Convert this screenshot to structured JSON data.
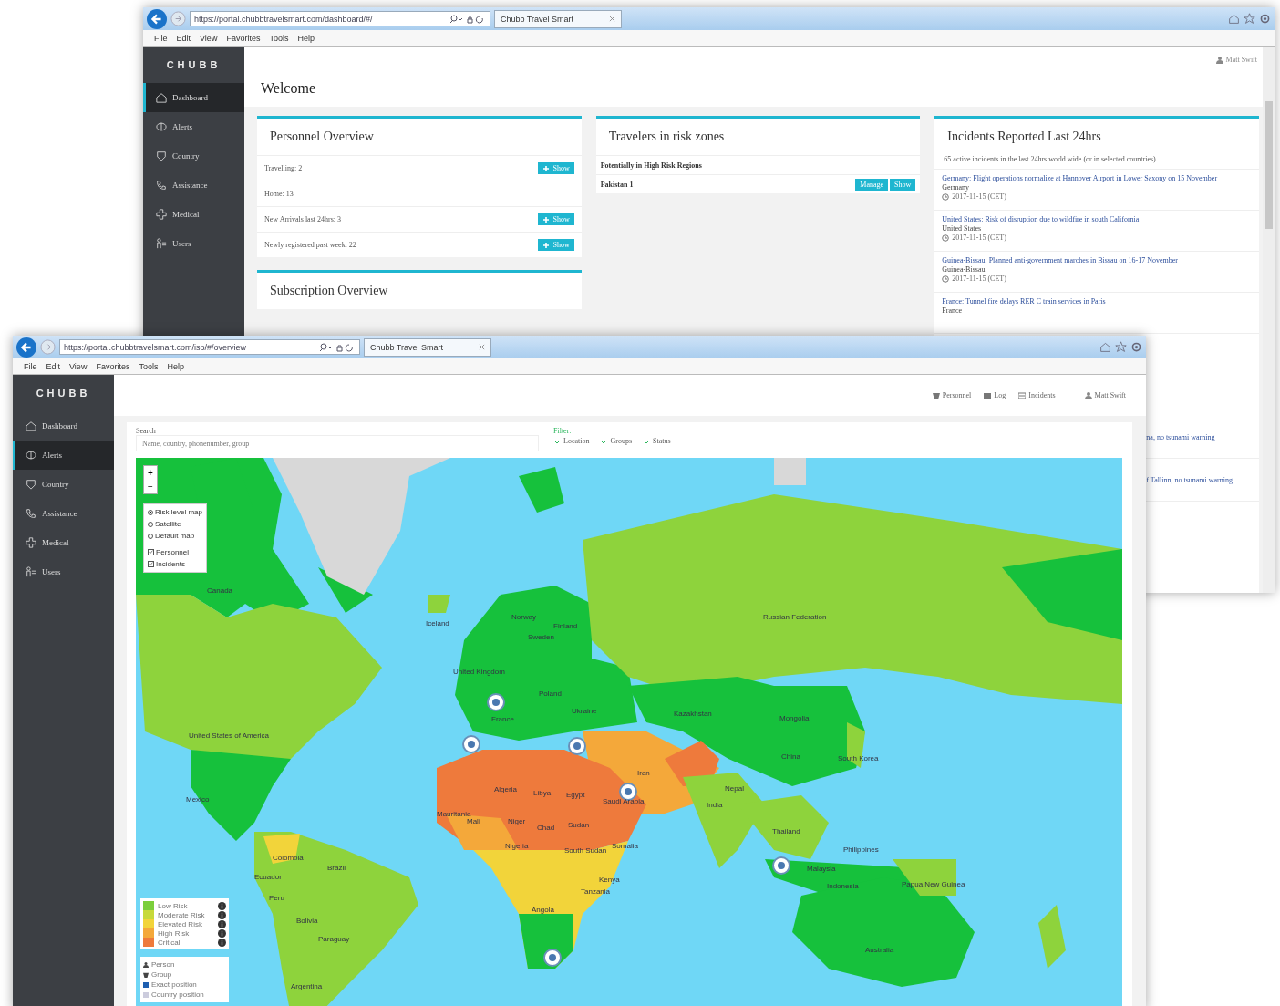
{
  "dashboard_window": {
    "browser": {
      "url": "https://portal.chubbtravelsmart.com/dashboard/#/",
      "tab_title": "Chubb Travel Smart",
      "menu": [
        "File",
        "Edit",
        "View",
        "Favorites",
        "Tools",
        "Help"
      ]
    },
    "logo": "CHUBB",
    "sidebar": [
      {
        "label": "Dashboard",
        "selected": true
      },
      {
        "label": "Alerts",
        "selected": false
      },
      {
        "label": "Country",
        "selected": false
      },
      {
        "label": "Assistance",
        "selected": false
      },
      {
        "label": "Medical",
        "selected": false
      },
      {
        "label": "Users",
        "selected": false
      }
    ],
    "user": "Matt Swift",
    "page_title": "Welcome",
    "personnel": {
      "title": "Personnel Overview",
      "rows": [
        {
          "label": "Travelling: 2",
          "button": "Show"
        },
        {
          "label": "Home: 13"
        },
        {
          "label": "New Arrivals last 24hrs: 3",
          "button": "Show"
        },
        {
          "label": "Newly registered past week: 22",
          "button": "Show"
        }
      ]
    },
    "subscription": {
      "title": "Subscription Overview"
    },
    "travelers": {
      "title": "Travelers in risk zones",
      "subtitle": "Potentially in High Risk Regions",
      "rows": [
        {
          "label": "Pakistan 1",
          "buttons": [
            "Manage",
            "Show"
          ]
        }
      ]
    },
    "incidents": {
      "title": "Incidents Reported Last 24hrs",
      "summary": "65 active incidents in the last 24hrs world wide (or in selected countries).",
      "items": [
        {
          "title": "Germany: Flight operations normalize at Hannover Airport in Lower Saxony on 15 November",
          "location": "Germany",
          "date": "2017-11-15 (CET)"
        },
        {
          "title": "United States: Risk of disruption due to wildfire in south California",
          "location": "United States",
          "date": "2017-11-15 (CET)"
        },
        {
          "title": "Guinea-Bissau: Planned anti-government marches in Bissau on 16-17 November",
          "location": "Guinea-Bissau",
          "date": "2017-11-15 (CET)"
        },
        {
          "title": "France: Tunnel fire delays RER C train services in Paris",
          "location": "France"
        }
      ],
      "fragments": [
        "na, no tsunami warning",
        "f Tallinn, no tsunami warning"
      ]
    }
  },
  "map_window": {
    "browser": {
      "url": "https://portal.chubbtravelsmart.com/iso/#/overview",
      "tab_title": "Chubb Travel Smart",
      "menu": [
        "File",
        "Edit",
        "View",
        "Favorites",
        "Tools",
        "Help"
      ]
    },
    "logo": "CHUBB",
    "sidebar": [
      {
        "label": "Dashboard",
        "selected": false
      },
      {
        "label": "Alerts",
        "selected": true
      },
      {
        "label": "Country",
        "selected": false
      },
      {
        "label": "Assistance",
        "selected": false
      },
      {
        "label": "Medical",
        "selected": false
      },
      {
        "label": "Users",
        "selected": false
      }
    ],
    "nav": [
      "Personnel",
      "Log",
      "Incidents"
    ],
    "user": "Matt Swift",
    "search": {
      "label": "Search",
      "placeholder": "Name, country, phonenumber, group"
    },
    "filter": {
      "label": "Filter:",
      "options": [
        "Location",
        "Groups",
        "Status"
      ]
    },
    "zoom": [
      "+",
      "−"
    ],
    "layers": [
      {
        "label": "Risk level map",
        "kind": "radio",
        "selected": true
      },
      {
        "label": "Satellite",
        "kind": "radio",
        "selected": false
      },
      {
        "label": "Default map",
        "kind": "radio",
        "selected": false
      },
      {
        "label": "Personnel",
        "kind": "checkbox",
        "checked": true
      },
      {
        "label": "Incidents",
        "kind": "checkbox",
        "checked": true
      }
    ],
    "risk_legend": [
      {
        "label": "Low Risk",
        "color": "#7ccf3c"
      },
      {
        "label": "Moderate Risk",
        "color": "#c7d93a"
      },
      {
        "label": "Elevated Risk",
        "color": "#f2d43a"
      },
      {
        "label": "High Risk",
        "color": "#f4a83a"
      },
      {
        "label": "Critical",
        "color": "#ee7a3c"
      }
    ],
    "marker_legend": [
      {
        "label": "Person",
        "kind": "person"
      },
      {
        "label": "Group",
        "kind": "group"
      },
      {
        "label": "Exact position",
        "kind": "exact"
      },
      {
        "label": "Country position",
        "kind": "country"
      }
    ],
    "map_labels": [
      "Canada",
      "United States of America",
      "Mexico",
      "Colombia",
      "Ecuador",
      "Brazil",
      "Peru",
      "Bolivia",
      "Paraguay",
      "Argentina",
      "Iceland",
      "Norway",
      "Sweden",
      "Finland",
      "United Kingdom",
      "France",
      "Poland",
      "Ukraine",
      "Russian Federation",
      "Kazakhstan",
      "Mongolia",
      "China",
      "Iran",
      "India",
      "Nepal",
      "Algeria",
      "Libya",
      "Egypt",
      "Mauritania",
      "Mali",
      "Niger",
      "Chad",
      "Sudan",
      "Nigeria",
      "South Sudan",
      "Somalia",
      "Kenya",
      "Tanzania",
      "Angola",
      "Saudi Arabia",
      "Thailand",
      "Malaysia",
      "Philippines",
      "Indonesia",
      "Papua New Guinea",
      "Australia",
      "South Korea"
    ]
  }
}
